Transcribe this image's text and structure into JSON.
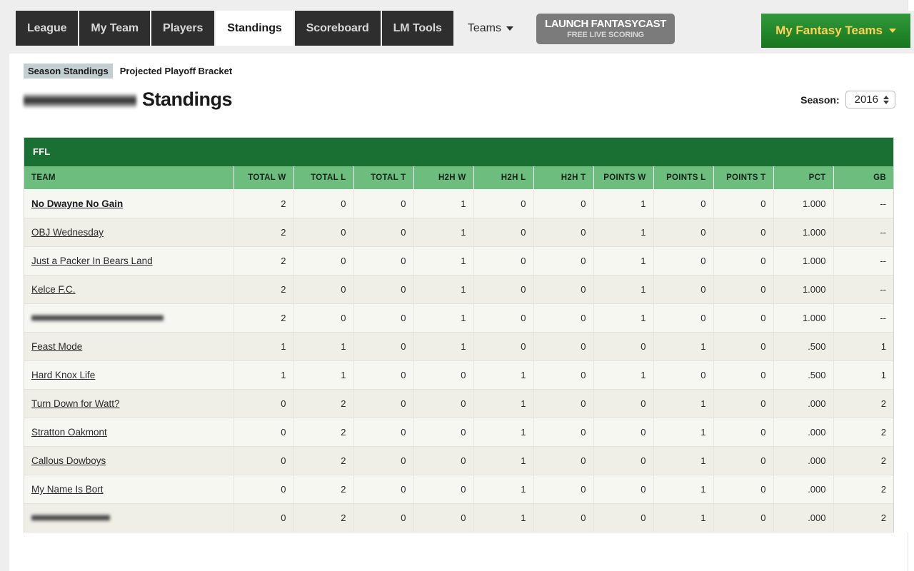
{
  "nav": {
    "tabs": [
      {
        "label": "League",
        "active": false
      },
      {
        "label": "My Team",
        "active": false
      },
      {
        "label": "Players",
        "active": false
      },
      {
        "label": "Standings",
        "active": true
      },
      {
        "label": "Scoreboard",
        "active": false
      },
      {
        "label": "LM Tools",
        "active": false
      }
    ],
    "teams_dropdown": "Teams",
    "fantasycast": {
      "main": "LAUNCH FANTASYCAST",
      "sub": "FREE LIVE SCORING"
    },
    "my_fantasy_teams": "My Fantasy Teams"
  },
  "subnav": {
    "items": [
      {
        "label": "Season Standings",
        "current": true
      },
      {
        "label": "Projected Playoff Bracket",
        "current": false
      }
    ]
  },
  "page": {
    "league_name_redacted": "",
    "title": "Standings",
    "season_label": "Season:",
    "season_value": "2016"
  },
  "colors": {
    "header_dark_green": "#1a7032",
    "header_light_green": "#6dbe7e",
    "nav_dark": "#2e2e2e",
    "accent_gold": "#ffd257",
    "row_odd": "#f7f7f2",
    "row_even": "#efefe7"
  },
  "table": {
    "caption": "FFL",
    "columns": [
      "TEAM",
      "TOTAL W",
      "TOTAL L",
      "TOTAL T",
      "H2H W",
      "H2H L",
      "H2H T",
      "POINTS W",
      "POINTS L",
      "POINTS T",
      "PCT",
      "GB"
    ],
    "rows": [
      {
        "team": "No Dwayne No Gain",
        "redacted": false,
        "own": true,
        "values": [
          "2",
          "0",
          "0",
          "1",
          "0",
          "0",
          "1",
          "0",
          "0",
          "1.000",
          "--"
        ]
      },
      {
        "team": "OBJ Wednesday",
        "redacted": false,
        "own": false,
        "values": [
          "2",
          "0",
          "0",
          "1",
          "0",
          "0",
          "1",
          "0",
          "0",
          "1.000",
          "--"
        ]
      },
      {
        "team": "Just a Packer In Bears Land",
        "redacted": false,
        "own": false,
        "values": [
          "2",
          "0",
          "0",
          "1",
          "0",
          "0",
          "1",
          "0",
          "0",
          "1.000",
          "--"
        ]
      },
      {
        "team": "Kelce F.C.",
        "redacted": false,
        "own": false,
        "values": [
          "2",
          "0",
          "0",
          "1",
          "0",
          "0",
          "1",
          "0",
          "0",
          "1.000",
          "--"
        ]
      },
      {
        "team": "",
        "redacted": true,
        "own": false,
        "values": [
          "2",
          "0",
          "0",
          "1",
          "0",
          "0",
          "1",
          "0",
          "0",
          "1.000",
          "--"
        ]
      },
      {
        "team": "Feast Mode",
        "redacted": false,
        "own": false,
        "values": [
          "1",
          "1",
          "0",
          "1",
          "0",
          "0",
          "0",
          "1",
          "0",
          ".500",
          "1"
        ]
      },
      {
        "team": "Hard Knox Life",
        "redacted": false,
        "own": false,
        "values": [
          "1",
          "1",
          "0",
          "0",
          "1",
          "0",
          "1",
          "0",
          "0",
          ".500",
          "1"
        ]
      },
      {
        "team": "Turn Down for Watt?",
        "redacted": false,
        "own": false,
        "values": [
          "0",
          "2",
          "0",
          "0",
          "1",
          "0",
          "0",
          "1",
          "0",
          ".000",
          "2"
        ]
      },
      {
        "team": "Stratton Oakmont",
        "redacted": false,
        "own": false,
        "values": [
          "0",
          "2",
          "0",
          "0",
          "1",
          "0",
          "0",
          "1",
          "0",
          ".000",
          "2"
        ]
      },
      {
        "team": "Callous Dowboys",
        "redacted": false,
        "own": false,
        "values": [
          "0",
          "2",
          "0",
          "0",
          "1",
          "0",
          "0",
          "1",
          "0",
          ".000",
          "2"
        ]
      },
      {
        "team": "My Name Is Bort",
        "redacted": false,
        "own": false,
        "values": [
          "0",
          "2",
          "0",
          "0",
          "1",
          "0",
          "0",
          "1",
          "0",
          ".000",
          "2"
        ]
      },
      {
        "team": "",
        "redacted": true,
        "own": false,
        "values": [
          "0",
          "2",
          "0",
          "0",
          "1",
          "0",
          "0",
          "1",
          "0",
          ".000",
          "2"
        ]
      }
    ]
  }
}
